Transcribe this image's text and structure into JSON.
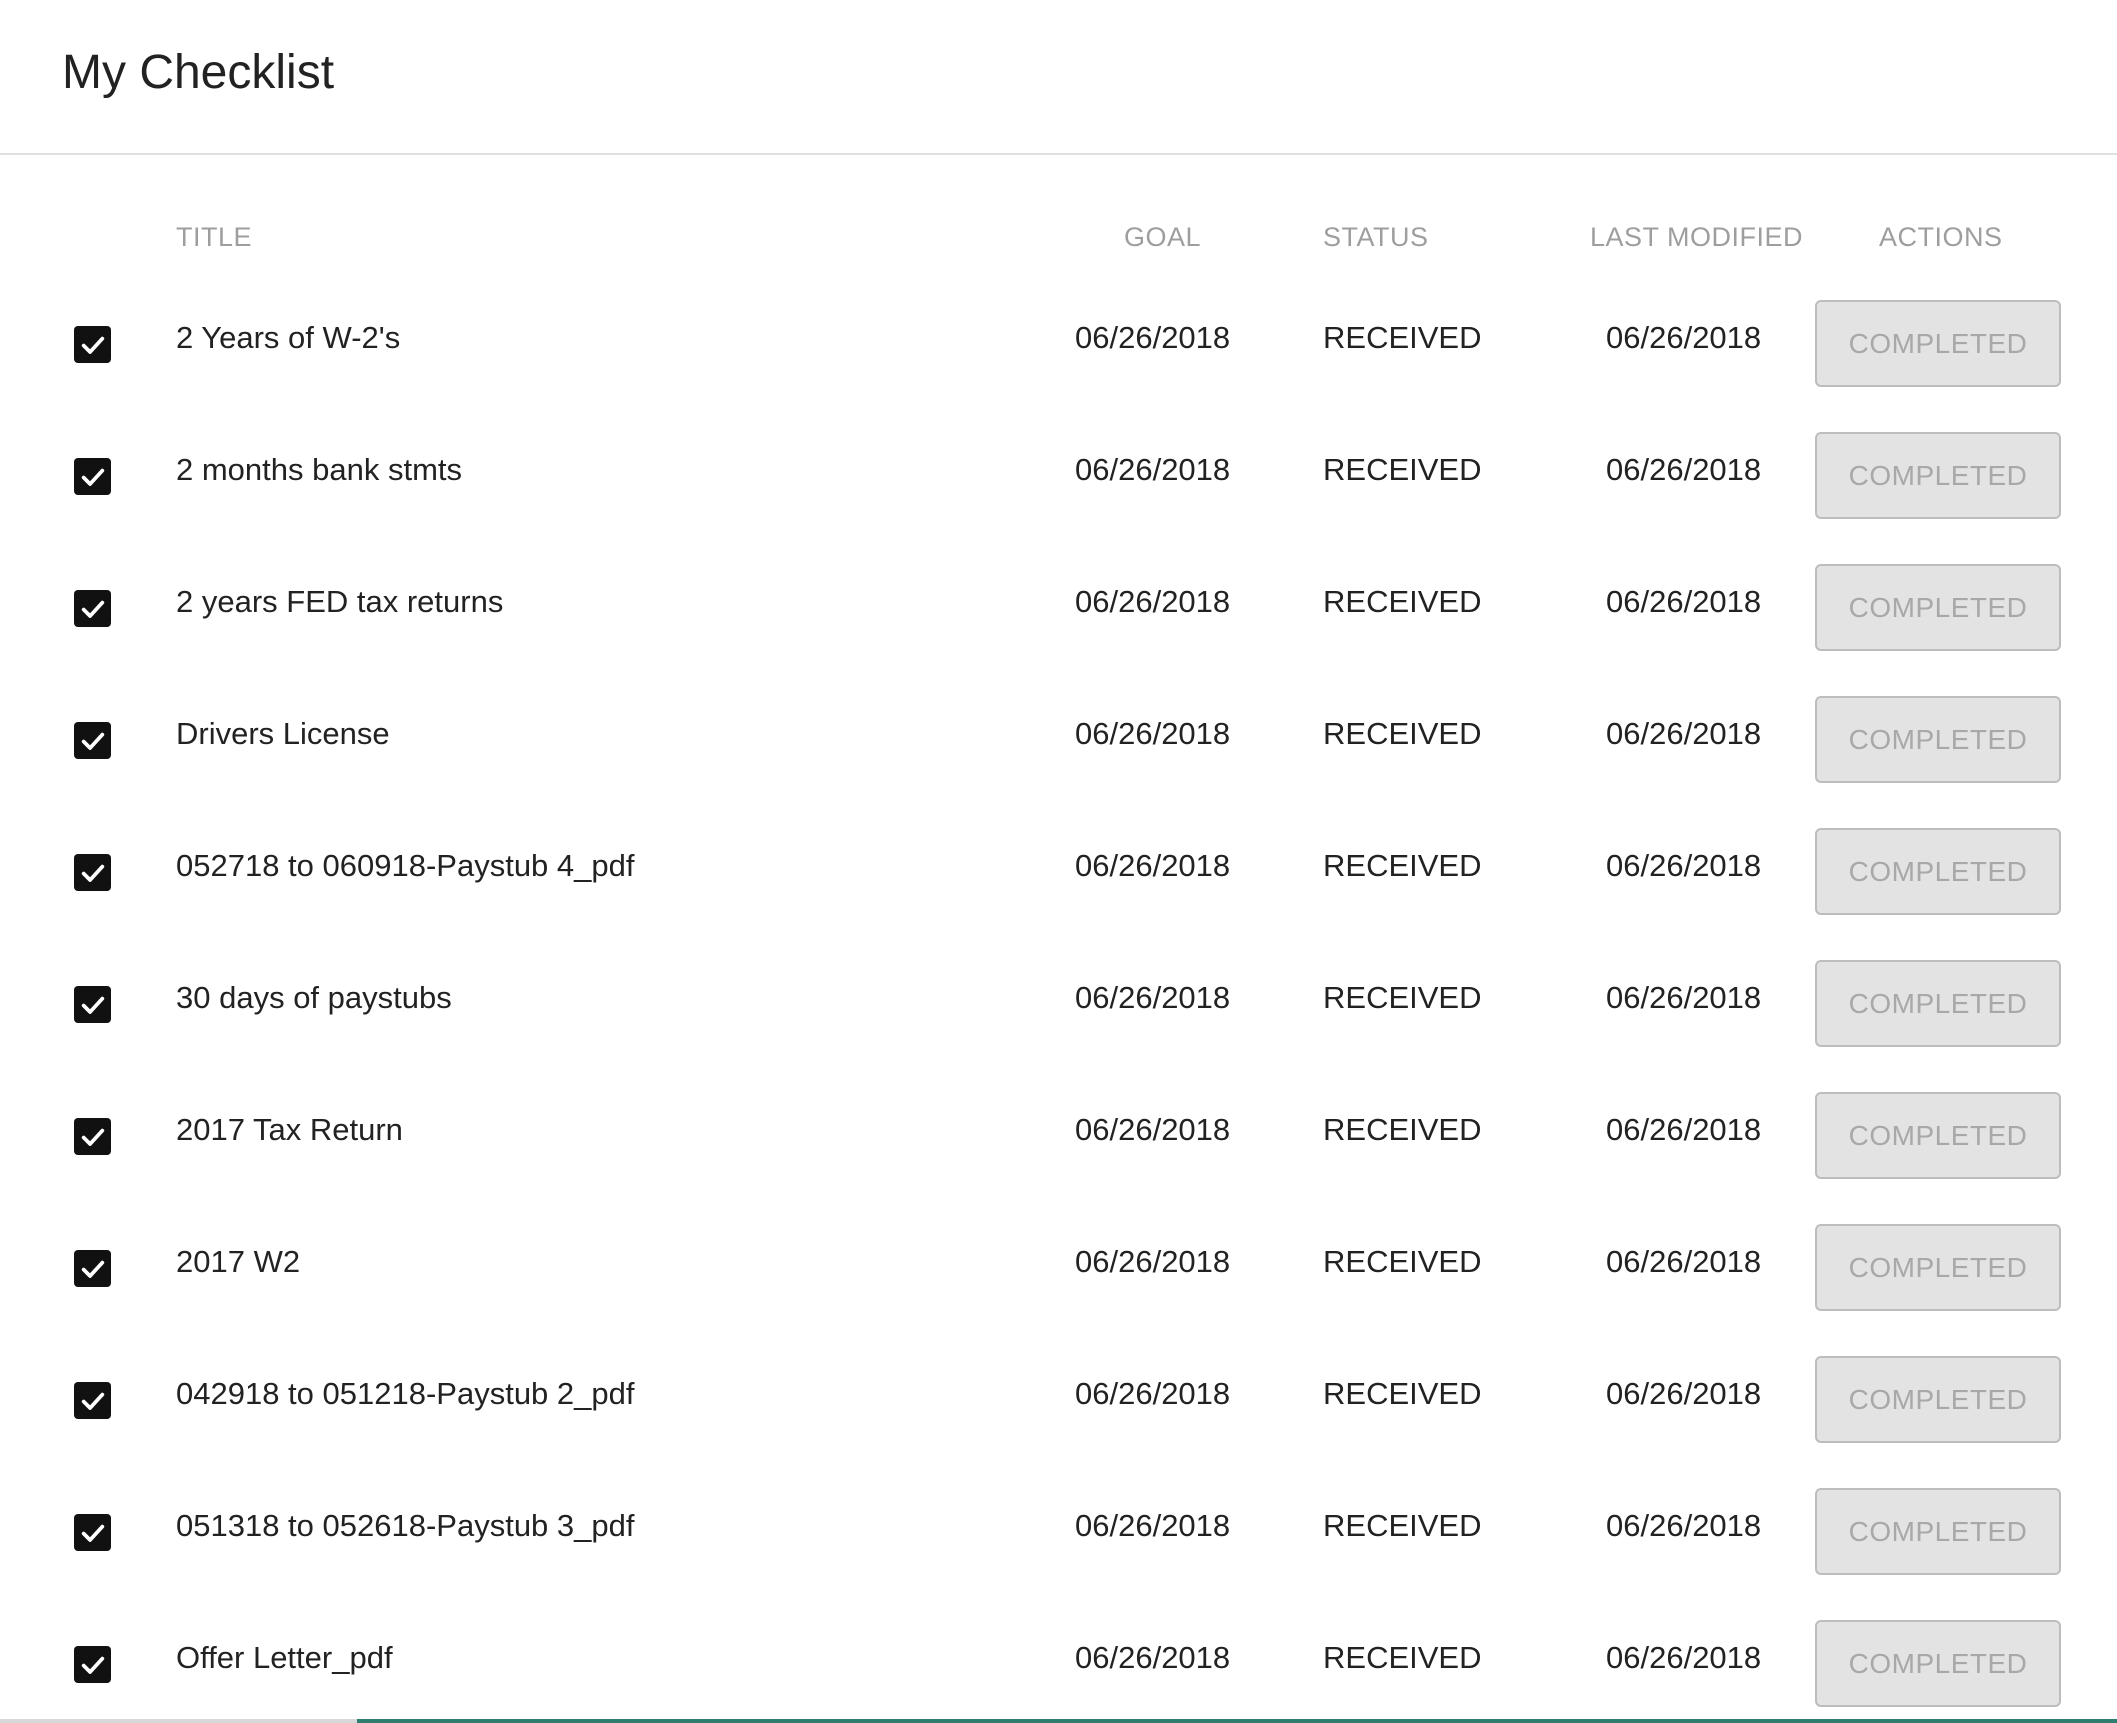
{
  "header": {
    "title": "My Checklist"
  },
  "columns": {
    "title": "TITLE",
    "goal": "GOAL",
    "status": "STATUS",
    "last_modified": "LAST MODIFIED",
    "actions": "ACTIONS"
  },
  "rows": [
    {
      "checked": true,
      "title": "2 Years of W-2's",
      "goal": "06/26/2018",
      "status": "RECEIVED",
      "last_modified": "06/26/2018",
      "action": "COMPLETED"
    },
    {
      "checked": true,
      "title": "2 months bank stmts",
      "goal": "06/26/2018",
      "status": "RECEIVED",
      "last_modified": "06/26/2018",
      "action": "COMPLETED"
    },
    {
      "checked": true,
      "title": "2 years FED tax returns",
      "goal": "06/26/2018",
      "status": "RECEIVED",
      "last_modified": "06/26/2018",
      "action": "COMPLETED"
    },
    {
      "checked": true,
      "title": "Drivers License",
      "goal": "06/26/2018",
      "status": "RECEIVED",
      "last_modified": "06/26/2018",
      "action": "COMPLETED"
    },
    {
      "checked": true,
      "title": "052718 to 060918-Paystub 4_pdf",
      "goal": "06/26/2018",
      "status": "RECEIVED",
      "last_modified": "06/26/2018",
      "action": "COMPLETED"
    },
    {
      "checked": true,
      "title": "30 days of paystubs",
      "goal": "06/26/2018",
      "status": "RECEIVED",
      "last_modified": "06/26/2018",
      "action": "COMPLETED"
    },
    {
      "checked": true,
      "title": "2017 Tax Return",
      "goal": "06/26/2018",
      "status": "RECEIVED",
      "last_modified": "06/26/2018",
      "action": "COMPLETED"
    },
    {
      "checked": true,
      "title": "2017 W2",
      "goal": "06/26/2018",
      "status": "RECEIVED",
      "last_modified": "06/26/2018",
      "action": "COMPLETED"
    },
    {
      "checked": true,
      "title": "042918 to 051218-Paystub 2_pdf",
      "goal": "06/26/2018",
      "status": "RECEIVED",
      "last_modified": "06/26/2018",
      "action": "COMPLETED"
    },
    {
      "checked": true,
      "title": "051318 to 052618-Paystub 3_pdf",
      "goal": "06/26/2018",
      "status": "RECEIVED",
      "last_modified": "06/26/2018",
      "action": "COMPLETED"
    },
    {
      "checked": true,
      "title": "Offer Letter_pdf",
      "goal": "06/26/2018",
      "status": "RECEIVED",
      "last_modified": "06/26/2018",
      "action": "COMPLETED"
    }
  ],
  "icons": {
    "checkbox": "checkbox-checked-icon"
  },
  "colors": {
    "checkbox": "#111111",
    "button_bg": "#e3e3e3",
    "button_text": "#a8a8a8",
    "header_text": "#9e9e9e",
    "accent": "#2e7d6f"
  }
}
